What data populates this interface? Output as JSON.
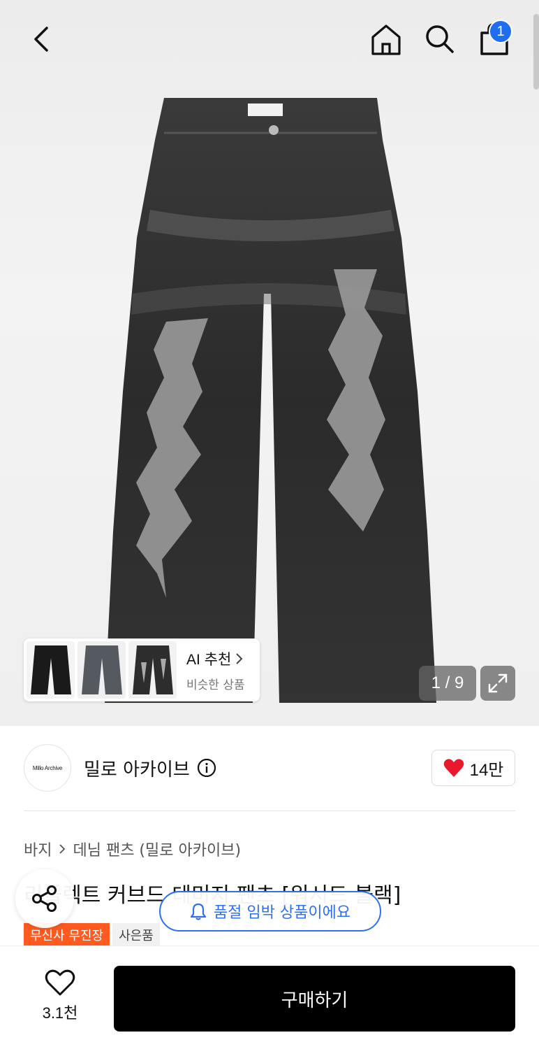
{
  "header": {
    "cart_count": "1"
  },
  "gallery": {
    "counter": "1 / 9",
    "ai_card": {
      "title": "AI 추천",
      "subtitle": "비슷한 상품"
    }
  },
  "brand": {
    "logo_text": "Millo Archive",
    "name": "밀로 아카이브",
    "likes": "14만"
  },
  "breadcrumb": {
    "category": "바지",
    "subcategory": "데님 팬츠 (밀로 아카이브)"
  },
  "product": {
    "title": "리플렉트 커브드 데미지 팬츠 [워시드 블랙]",
    "tags": [
      "무신사 무진장",
      "사은품"
    ]
  },
  "toast": {
    "text": "품절 임박 상품이에요"
  },
  "bottom_bar": {
    "wish_count": "3.1천",
    "buy_label": "구매하기"
  },
  "colors": {
    "accent_blue": "#1f6ef2",
    "tag_orange": "#ff5a1f",
    "like_red": "#e8192c",
    "buy_black": "#000000"
  }
}
